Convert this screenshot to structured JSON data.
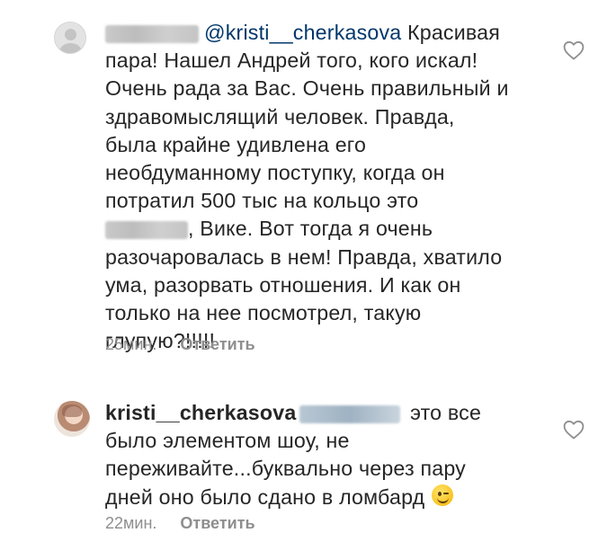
{
  "comments": [
    {
      "mention": "@kristi__cherkasova",
      "lines": [
        "Красивая",
        "пара!  Нашел Андрей того, кого искал!",
        "Очень рада за Вас. Очень правильный и",
        "здравомыслящий человек. Правда,",
        "была крайне удивлена его",
        "необдуманному поступку, когда он",
        "потратил 500 тыс на кольцо это",
        ", Вике. Вот тогда я очень",
        "разочаровалась в нем! Правда, хватило",
        "ума, разорвать отношения. И как он",
        "только на нее посмотрел, такую",
        "глупую?!!!!!"
      ],
      "time": "25мин.",
      "reply": "Ответить"
    },
    {
      "username": "kristi__cherkasova",
      "lines": [
        "это все",
        "было элементом шоу, не",
        "переживайте...буквально через пару",
        "дней оно было сдано в ломбард"
      ],
      "time": "22мин.",
      "reply": "Ответить"
    }
  ],
  "icons": {
    "like": "heart-outline-icon",
    "emoji": "winking-face-emoji"
  },
  "colors": {
    "mention": "#00376b",
    "meta": "#8e8e8e",
    "text": "#262626"
  }
}
